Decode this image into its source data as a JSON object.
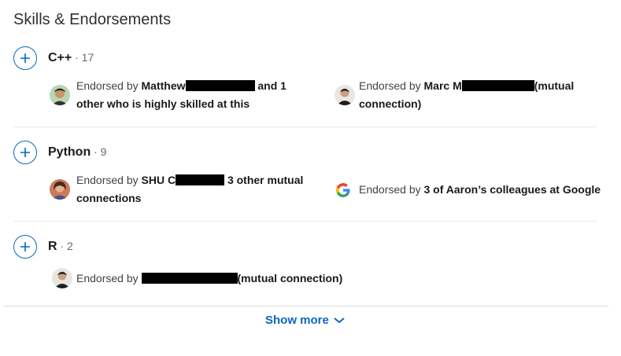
{
  "section_title": "Skills & Endorsements",
  "skills": [
    {
      "name": "C++",
      "count_text": " · 17",
      "endorsements": [
        {
          "prefix": "Endorsed by ",
          "name_bold_start": "Matthew",
          "after_redaction": " and 1",
          "line2": "other who is highly skilled at this",
          "avatar": "avatar-person-1"
        },
        {
          "prefix": "Endorsed by ",
          "name_bold_start": "Marc M",
          "after_redaction": "(mutual",
          "line2": "connection)",
          "avatar": "avatar-person-2"
        }
      ]
    },
    {
      "name": "Python",
      "count_text": " · 9",
      "endorsements": [
        {
          "prefix": "Endorsed by ",
          "name_bold_start": "SHU C",
          "after_redaction": " 3 other mutual",
          "line2": "connections",
          "avatar": "avatar-person-3"
        },
        {
          "prefix": "Endorsed by ",
          "bold_text": "3 of Aaron’s colleagues at Google",
          "icon": "google-icon"
        }
      ]
    },
    {
      "name": "R",
      "count_text": " · 2",
      "endorsements": [
        {
          "prefix": "Endorsed by ",
          "after_redaction": "(mutual connection)",
          "avatar": "avatar-person-2"
        }
      ]
    }
  ],
  "show_more_label": "Show more",
  "colors": {
    "accent": "#0a66c2",
    "divider": "#e6e9ec"
  }
}
